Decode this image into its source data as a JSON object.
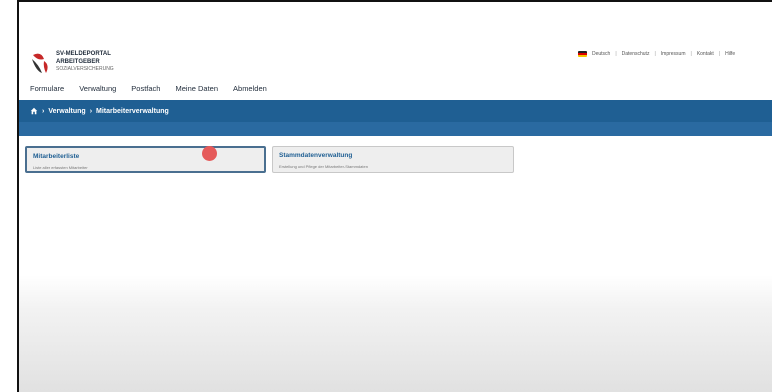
{
  "logo": {
    "line1": "SV-MELDEPORTAL",
    "line2": "ARBEITGEBER",
    "line3": "SOZIALVERSICHERUNG"
  },
  "toplinks": {
    "language": "Deutsch",
    "privacy": "Datenschutz",
    "imprint": "Impressum",
    "contact": "Kontakt",
    "help": "Hilfe"
  },
  "nav": {
    "items": [
      "Formulare",
      "Verwaltung",
      "Postfach",
      "Meine Daten",
      "Abmelden"
    ]
  },
  "breadcrumb": {
    "separator": "›",
    "level1": "Verwaltung",
    "level2": "Mitarbeiterverwaltung"
  },
  "cards": [
    {
      "title": "Mitarbeiterliste",
      "desc": "Liste aller erfassten Mitarbeiter"
    },
    {
      "title": "Stammdatenverwaltung",
      "desc": "Erstellung und Pflege der Mitarbeiter-Stammdaten"
    }
  ],
  "colors": {
    "brand_blue": "#1f5f93",
    "cursor": "#e55a5a"
  }
}
